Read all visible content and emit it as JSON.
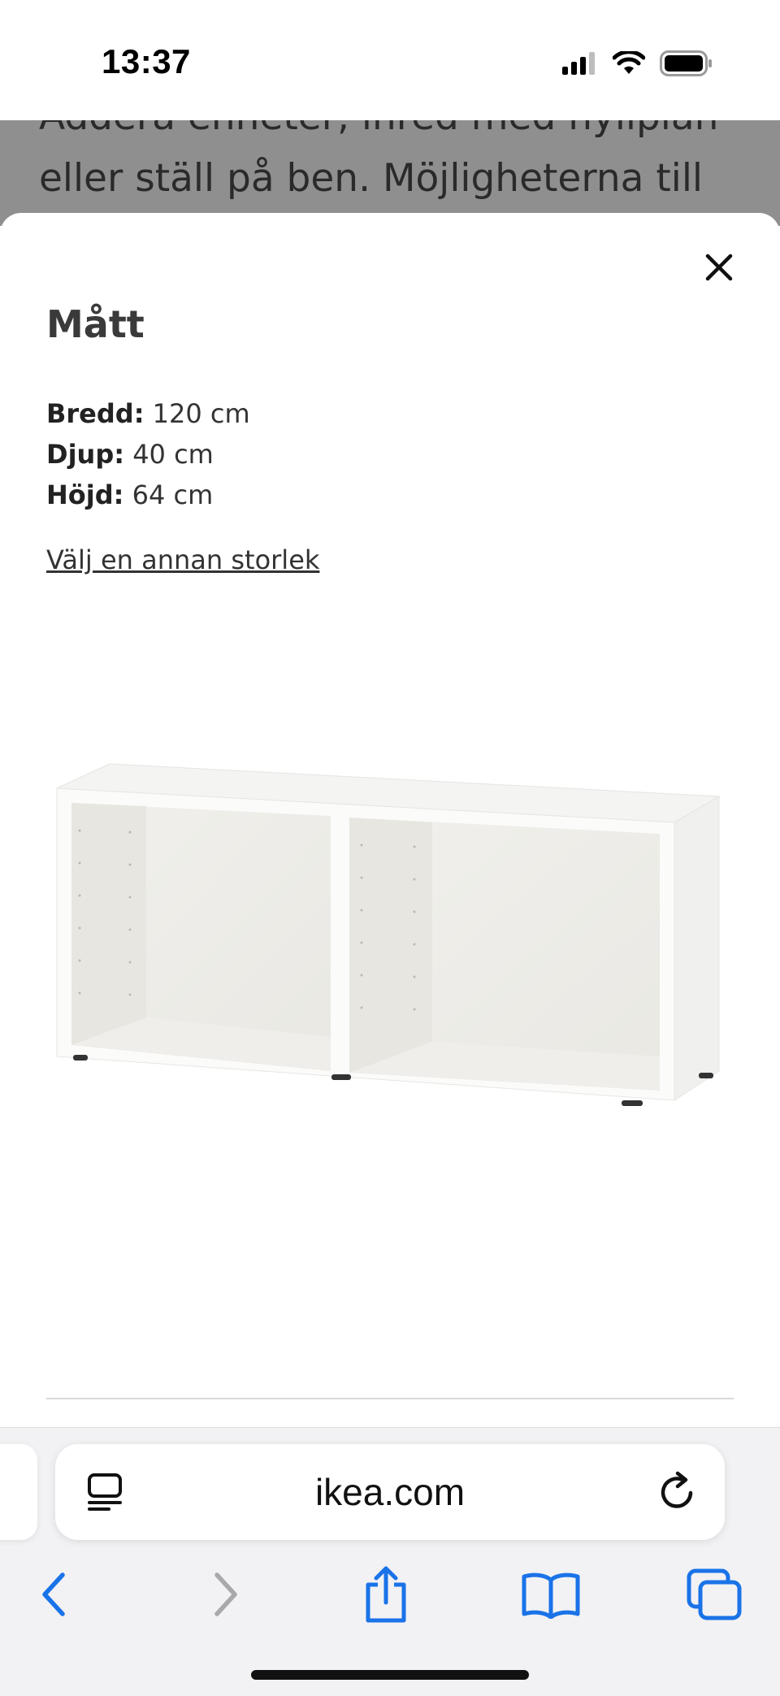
{
  "status_bar": {
    "time": "13:37",
    "icons": [
      "signal-icon",
      "wifi-icon",
      "battery-icon"
    ]
  },
  "background_page": {
    "text": "Addera enheter, inred med hyllplan eller ställ på ben. Möjligheterna till bra"
  },
  "modal": {
    "heading": "Mått",
    "specs": [
      {
        "label": "Bredd:",
        "value": "120 cm"
      },
      {
        "label": "Djup:",
        "value": "40 cm"
      },
      {
        "label": "Höjd:",
        "value": "64 cm"
      }
    ],
    "other_size_link": "Välj en annan storlek"
  },
  "browser": {
    "url": "ikea.com",
    "accent": "#1a73e8",
    "toolbar_icons": [
      "back-icon",
      "forward-icon",
      "share-icon",
      "bookmarks-icon",
      "tabs-icon"
    ]
  }
}
